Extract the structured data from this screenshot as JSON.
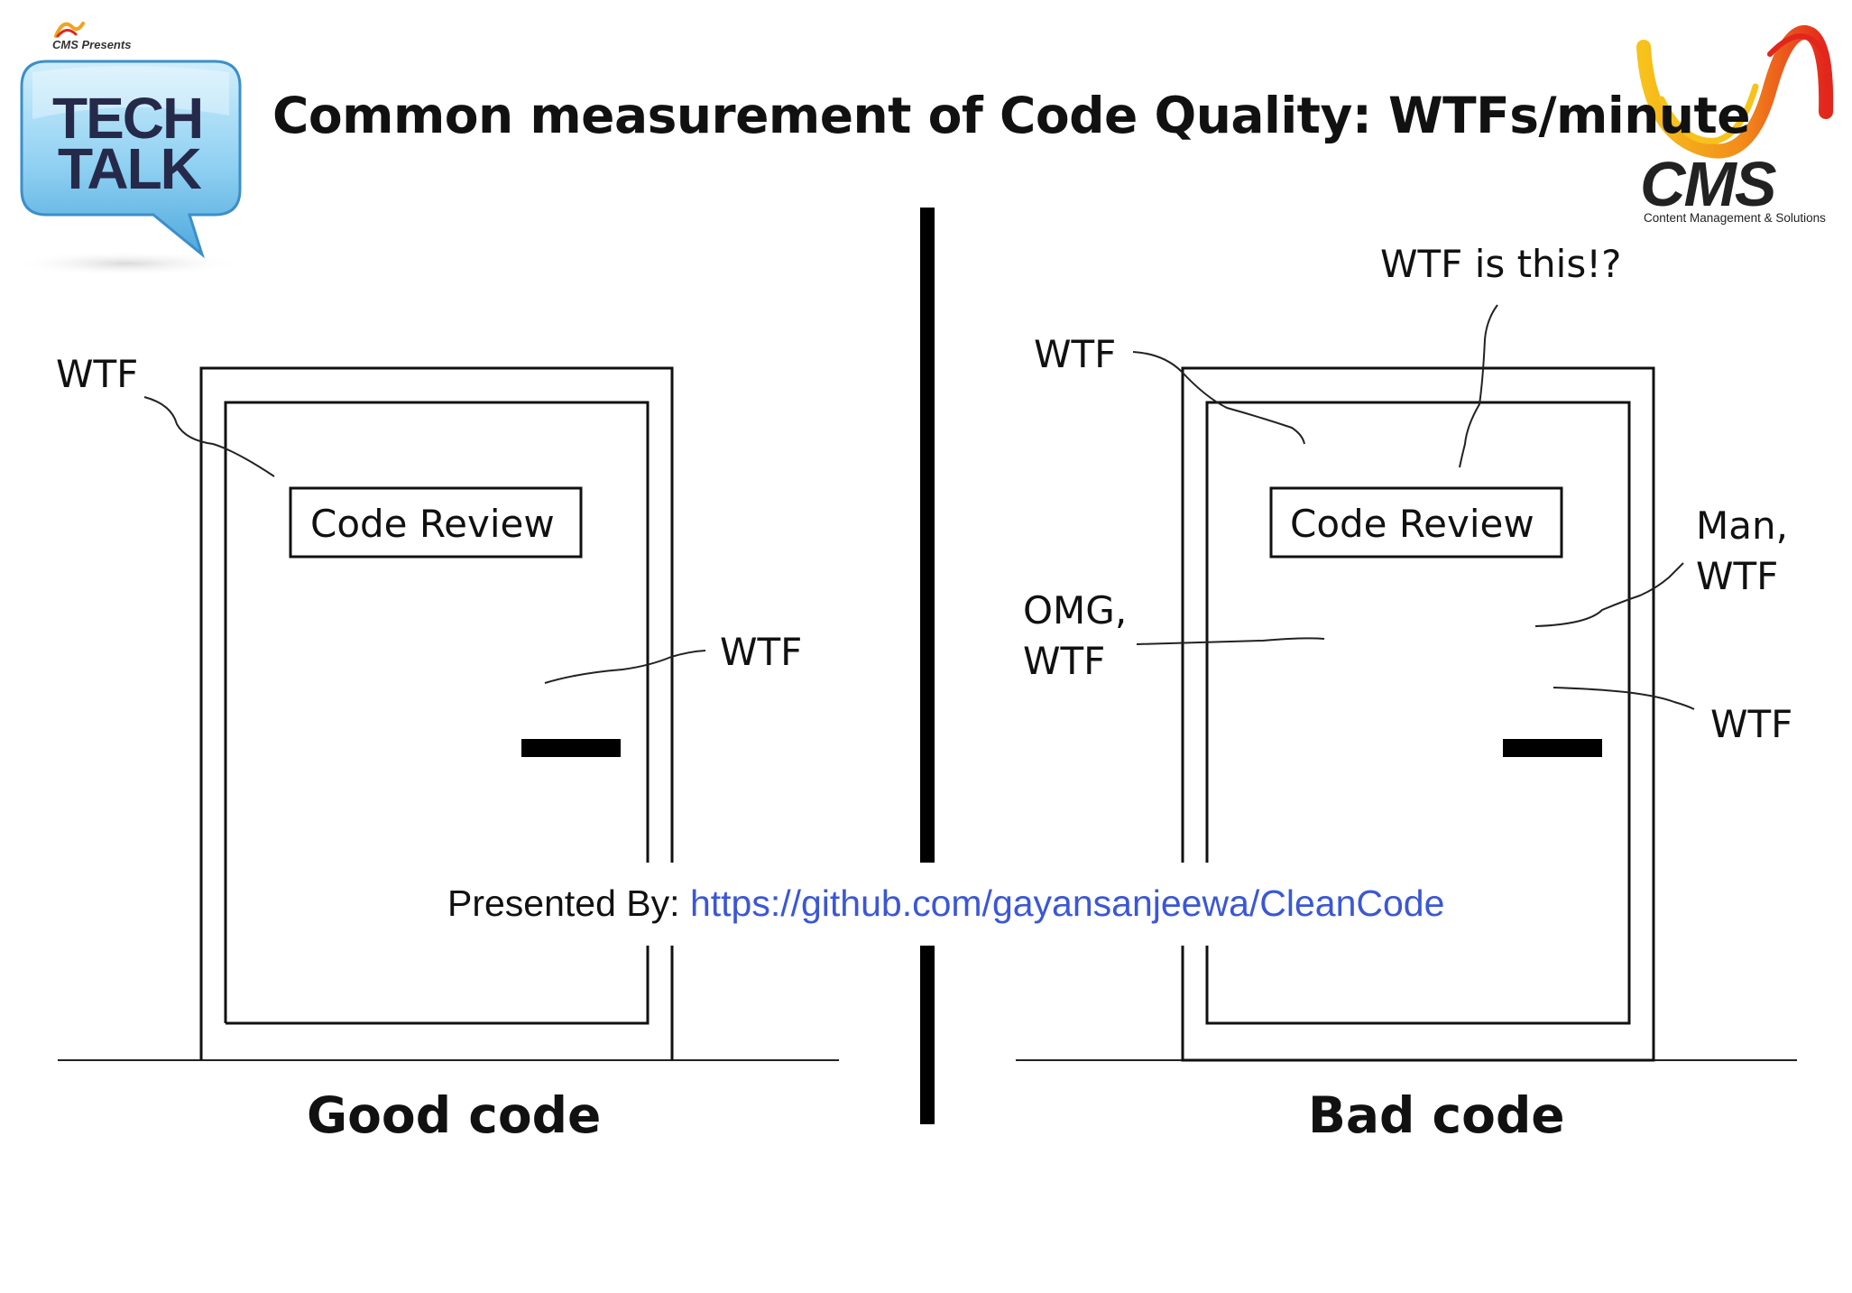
{
  "title": "Common measurement of Code Quality: WTFs/minute",
  "logos": {
    "presents_text": "CMS Presents",
    "techtalk_line1": "TECH",
    "techtalk_line2": "TALK",
    "cms_word": "CMS",
    "cms_tagline": "Content Management & Solutions"
  },
  "good_side": {
    "caption": "Good code",
    "sign": "Code Review",
    "labels": [
      "WTF",
      "WTF"
    ]
  },
  "bad_side": {
    "caption": "Bad code",
    "sign": "Code Review",
    "labels": {
      "top_left": "WTF",
      "top_right": "WTF is this!?",
      "left_line1": "OMG,",
      "left_line2": "WTF",
      "right_line1": "Man,",
      "right_line2": "WTF",
      "bottom_right": "WTF"
    }
  },
  "footer": {
    "presented_label": "Presented By: ",
    "link": "https://github.com/gayansanjeewa/CleanCode"
  },
  "colors": {
    "link": "#3b57d6",
    "bubble": "#8fd0f2",
    "swoosh_yellow": "#f7c21b",
    "swoosh_red": "#e2261c"
  }
}
